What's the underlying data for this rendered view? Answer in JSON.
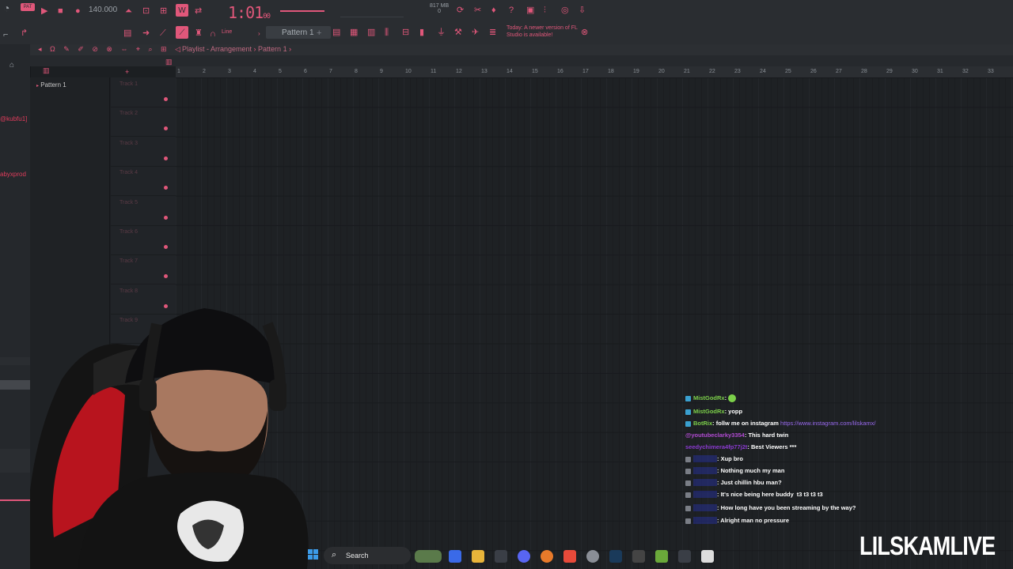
{
  "toolbar": {
    "tempo": "140.000",
    "timecode": "1:01",
    "timecode_sub": "00",
    "memory": "817 MB",
    "memory_sub": "0",
    "pattern": "Pattern 1",
    "line_mode": "Line",
    "update_news": "Today: A newer version of FL Studio is available!"
  },
  "browser": {
    "names": [
      "@kubfu1]",
      "abyxprod"
    ]
  },
  "playlist": {
    "title": "Playlist - Arrangement",
    "pattern": "Pattern 1",
    "pattern_list": [
      "Pattern 1"
    ],
    "ruler": [
      "1",
      "2",
      "3",
      "4",
      "5",
      "6",
      "7",
      "8",
      "9",
      "10",
      "11",
      "12",
      "13",
      "14",
      "15",
      "16",
      "17",
      "18",
      "19",
      "20",
      "21",
      "22",
      "23",
      "24",
      "25",
      "26",
      "27",
      "28",
      "29",
      "30",
      "31",
      "32",
      "33"
    ],
    "tracks": [
      "Track 1",
      "Track 2",
      "Track 3",
      "Track 4",
      "Track 5",
      "Track 6",
      "Track 7",
      "Track 8",
      "Track 9"
    ]
  },
  "chat": [
    {
      "user": "MistGodRx",
      "text": ":",
      "user_color": "#7cd04a",
      "emote": "green"
    },
    {
      "user": "MistGodRx",
      "text": ": yopp",
      "user_color": "#7cd04a"
    },
    {
      "user": "BotRix",
      "text": ": follw me on instagram",
      "user_color": "#7cd04a",
      "link": "https://www.instagram.com/lilskamx/"
    },
    {
      "user": "@youtubeclarky3354",
      "text": ": This hard twin",
      "user_color": "#b04ad0"
    },
    {
      "user": "seedychimera4fp77j2t",
      "text": ": Best Viewers ***",
      "user_color": "#8a3ad0"
    },
    {
      "user": "blurred",
      "text": ": Xup bro",
      "user_color": "#2a3ad0"
    },
    {
      "user": "blurred",
      "text": ": Nothing much my man",
      "user_color": "#2a3ad0"
    },
    {
      "user": "blurred",
      "text": ": Just chillin hbu man?",
      "user_color": "#2a3ad0"
    },
    {
      "user": "blurred",
      "text": ": It's nice being here buddy",
      "user_color": "#2a3ad0",
      "tail": "t3 t3 t3 t3"
    },
    {
      "user": "blurred",
      "text": ": How long have you been streaming by the way?",
      "user_color": "#2a3ad0"
    },
    {
      "user": "blurred",
      "text": ": Alright man no pressure",
      "user_color": "#2a3ad0"
    }
  ],
  "taskbar": {
    "search_label": "Search"
  },
  "watermark": "LILSKAMLIVE",
  "colors": {
    "accent": "#e0577a",
    "background": "#1e2124",
    "chat_text": "#ffffff"
  }
}
